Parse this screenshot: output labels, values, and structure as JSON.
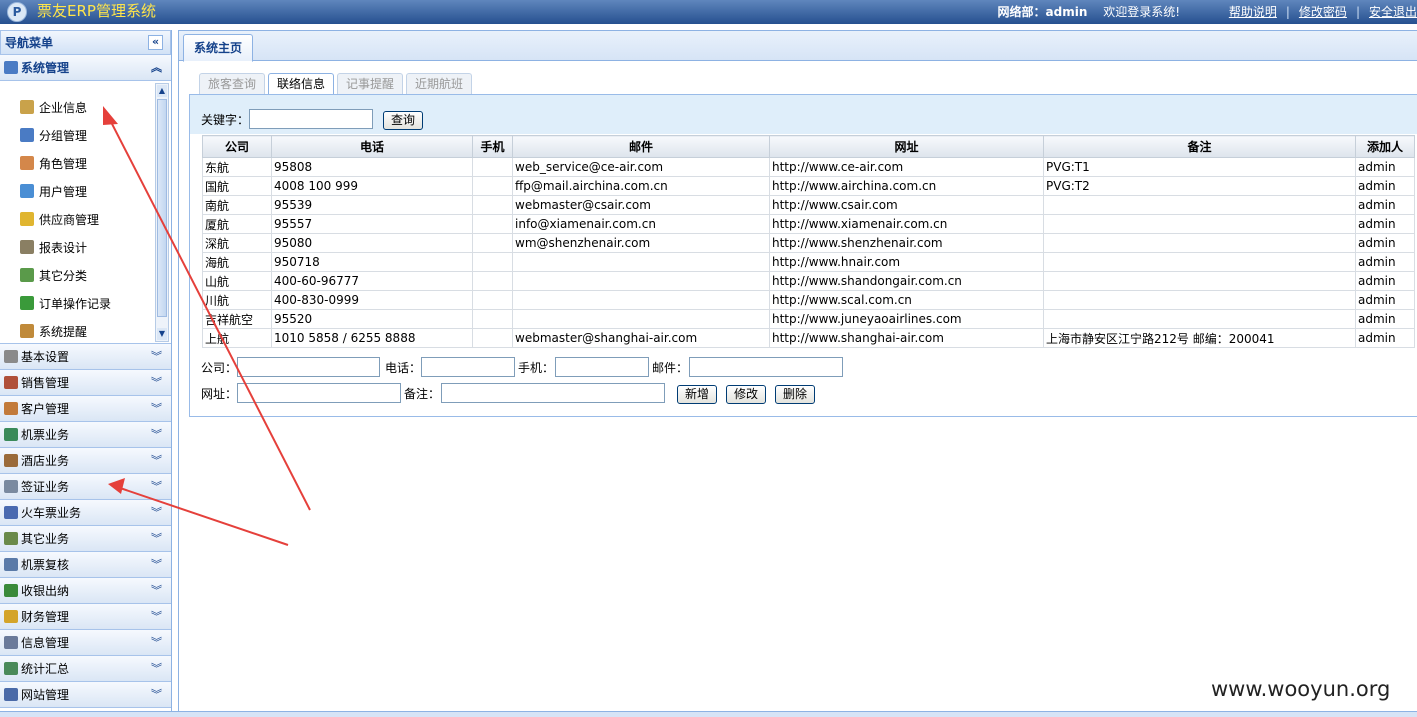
{
  "header": {
    "app_title": "票友ERP管理系统",
    "logo_letter": "P",
    "dept_user": "网络部：admin",
    "welcome": "欢迎登录系统!",
    "links": [
      "帮助说明",
      "修改密码",
      "安全退出"
    ]
  },
  "nav": {
    "title": "导航菜单",
    "collapse_symbol": "«",
    "active_group": {
      "label": "系统管理",
      "chevron": "︽"
    },
    "subitems": [
      {
        "label": "企业信息",
        "icon": "enterprise-icon",
        "color": "#c9a24a"
      },
      {
        "label": "分组管理",
        "icon": "group-icon",
        "color": "#4a7bc4"
      },
      {
        "label": "角色管理",
        "icon": "role-icon",
        "color": "#d4874a"
      },
      {
        "label": "用户管理",
        "icon": "user-icon",
        "color": "#4a8ed4"
      },
      {
        "label": "供应商管理",
        "icon": "supplier-icon",
        "color": "#e0b530"
      },
      {
        "label": "报表设计",
        "icon": "report-icon",
        "color": "#8a7f63"
      },
      {
        "label": "其它分类",
        "icon": "category-icon",
        "color": "#5a9a4a"
      },
      {
        "label": "订单操作记录",
        "icon": "order-log-icon",
        "color": "#3a9a3a"
      },
      {
        "label": "系统提醒",
        "icon": "reminder-icon",
        "color": "#c08a3a"
      }
    ],
    "groups": [
      {
        "label": "基本设置",
        "icon": "gear-icon",
        "color": "#8a8a8a"
      },
      {
        "label": "销售管理",
        "icon": "sales-icon",
        "color": "#b0503a"
      },
      {
        "label": "客户管理",
        "icon": "customer-icon",
        "color": "#c27a3a"
      },
      {
        "label": "机票业务",
        "icon": "ticket-icon",
        "color": "#3a8a5a"
      },
      {
        "label": "酒店业务",
        "icon": "hotel-icon",
        "color": "#9a6a3a"
      },
      {
        "label": "签证业务",
        "icon": "visa-icon",
        "color": "#7a8aa0"
      },
      {
        "label": "火车票业务",
        "icon": "train-icon",
        "color": "#4a6ab0"
      },
      {
        "label": "其它业务",
        "icon": "other-icon",
        "color": "#6a8a4a"
      },
      {
        "label": "机票复核",
        "icon": "review-icon",
        "color": "#5a7aa8"
      },
      {
        "label": "收银出纳",
        "icon": "yen-icon",
        "color": "#3a8a3a"
      },
      {
        "label": "财务管理",
        "icon": "finance-icon",
        "color": "#d4a42a"
      },
      {
        "label": "信息管理",
        "icon": "info-icon",
        "color": "#6a7a9a"
      },
      {
        "label": "统计汇总",
        "icon": "stats-icon",
        "color": "#4a8a5a"
      },
      {
        "label": "网站管理",
        "icon": "website-icon",
        "color": "#4a6aa8"
      }
    ],
    "group_chevron": "︾"
  },
  "main": {
    "tab": "系统主页",
    "subtabs": [
      "旅客查询",
      "联络信息",
      "记事提醒",
      "近期航班"
    ],
    "active_subtab": 1,
    "search": {
      "label": "关键字：",
      "button": "查询",
      "value": ""
    },
    "columns": [
      "公司",
      "电话",
      "手机",
      "邮件",
      "网址",
      "备注",
      "添加人"
    ],
    "rows": [
      [
        "东航",
        "95808",
        "",
        "web_service@ce-air.com",
        "http://www.ce-air.com",
        "PVG:T1",
        "admin"
      ],
      [
        "国航",
        "4008 100 999",
        "",
        "ffp@mail.airchina.com.cn",
        "http://www.airchina.com.cn",
        "PVG:T2",
        "admin"
      ],
      [
        "南航",
        "95539",
        "",
        "webmaster@csair.com",
        "http://www.csair.com",
        "",
        "admin"
      ],
      [
        "厦航",
        "95557",
        "",
        "info@xiamenair.com.cn",
        "http://www.xiamenair.com.cn",
        "",
        "admin"
      ],
      [
        "深航",
        "95080",
        "",
        "wm@shenzhenair.com",
        "http://www.shenzhenair.com",
        "",
        "admin"
      ],
      [
        "海航",
        "950718",
        "",
        "",
        "http://www.hnair.com",
        "",
        "admin"
      ],
      [
        "山航",
        "400-60-96777",
        "",
        "",
        "http://www.shandongair.com.cn",
        "",
        "admin"
      ],
      [
        "川航",
        "400-830-0999",
        "",
        "",
        "http://www.scal.com.cn",
        "",
        "admin"
      ],
      [
        "吉祥航空",
        "95520",
        "",
        "",
        "http://www.juneyaoairlines.com",
        "",
        "admin"
      ],
      [
        "上航",
        "1010 5858 / 6255 8888",
        "",
        "webmaster@shanghai-air.com",
        "http://www.shanghai-air.com",
        "上海市静安区江宁路212号 邮编：200041",
        "admin"
      ]
    ],
    "form": {
      "company": "公司：",
      "phone": "电话：",
      "mobile": "手机：",
      "email": "邮件：",
      "website": "网址：",
      "remark": "备注：",
      "add": "新增",
      "edit": "修改",
      "delete": "删除"
    }
  },
  "watermark": "www.wooyun.org",
  "annotation_color": "#e5403b"
}
